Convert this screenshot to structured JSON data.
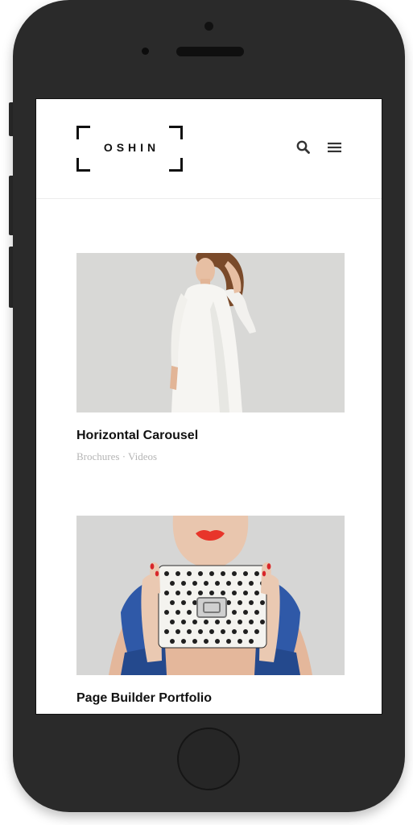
{
  "header": {
    "logo_text": "OSHIN"
  },
  "portfolio": [
    {
      "title": "Horizontal Carousel",
      "categories": [
        "Brochures",
        "Videos"
      ],
      "separator": "·"
    },
    {
      "title": "Page Builder Portfolio"
    }
  ]
}
